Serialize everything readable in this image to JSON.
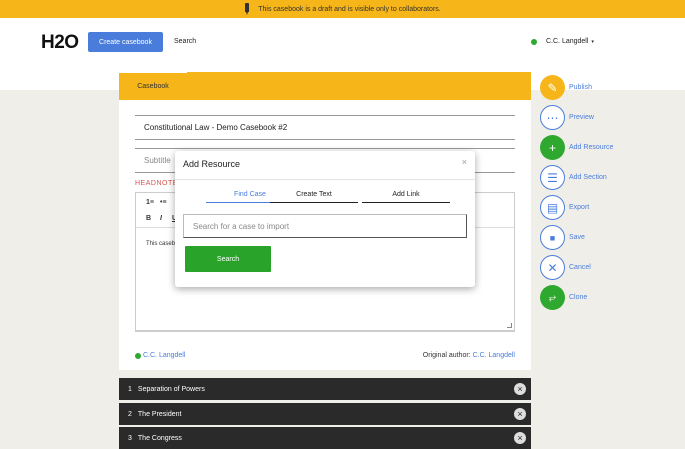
{
  "banner": {
    "text": "This casebook is a draft and is visible only to collaborators."
  },
  "header": {
    "logo": "H2O",
    "create_label": "Create casebook",
    "search_label": "Search",
    "user_name": "C.C. Langdell",
    "caret": "▾"
  },
  "tabs": {
    "active": "Casebook"
  },
  "editor": {
    "title_value": "Constitutional Law - Demo Casebook #2",
    "subtitle_placeholder": "Subtitle",
    "headnote_label": "HEADNOTE",
    "toolbar": {
      "ol": "1≡",
      "ul": "•≡",
      "bold": "B",
      "italic": "I",
      "underline": "U"
    },
    "content_preview": "This casebook",
    "footer_user": "C.C. Langdell",
    "original_author_prefix": "Original author:",
    "original_author": "C.C. Langdell"
  },
  "sections": [
    {
      "number": "1",
      "title": "Separation of Powers"
    },
    {
      "number": "2",
      "title": "The President"
    },
    {
      "number": "3",
      "title": "The Congress"
    }
  ],
  "actions": {
    "publish": "Publish",
    "preview": "Preview",
    "add_resource": "Add Resource",
    "add_section": "Add Section",
    "export": "Export",
    "save": "Save",
    "cancel": "Cancel",
    "clone": "Clone"
  },
  "modal": {
    "title": "Add Resource",
    "close": "×",
    "tabs": [
      "Find Case",
      "Create Text",
      "Add Link"
    ],
    "search_placeholder": "Search for a case to import",
    "search_button": "Search"
  },
  "colors": {
    "accent_yellow": "#f6b519",
    "link_blue": "#4a7ddb",
    "green": "#2ea82e",
    "dark_row": "#2a2a2a",
    "headnote_red": "#d9534f"
  }
}
